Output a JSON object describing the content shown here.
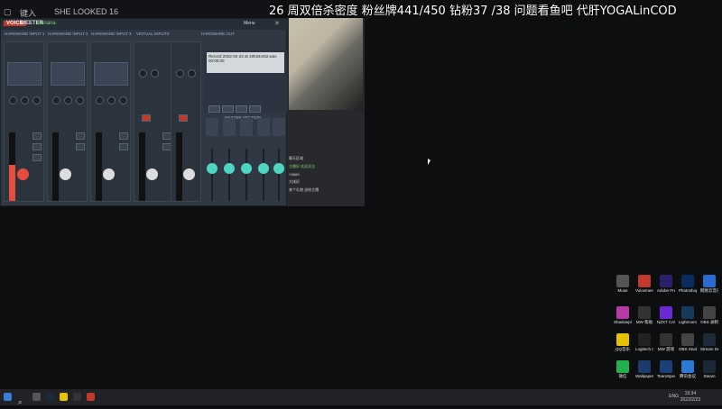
{
  "overlay": {
    "text": "26 周双倍杀密度 粉丝牌441/450 钻粉37 /38 问题看鱼吧 代肝YOGALinCOD"
  },
  "taskbar_top": {
    "item1": "键入",
    "item2": "SHE LOOKED 16"
  },
  "voicemeeter": {
    "logo_voice": "VOICE",
    "logo_meeter": "MEETER",
    "logo_banana": "Banana",
    "menu_label": "Menu",
    "channels": [
      "HARDWARE INPUT 1",
      "HARDWARE INPUT 2",
      "HARDWARE INPUT 3",
      "VIRTUAL INPUTS",
      "HARDWARE OUT"
    ],
    "master_section": "MASTER SECTION",
    "recorder_text": "Record 2022-02-23 at 19h34m52.wav",
    "recorder_time": "00:00:00"
  },
  "movie": {
    "chat_title": "聊天区域",
    "chat_lines": [
      "主播好 欢迎关注",
      "Y8888",
      "大佬好",
      "来个礼物 送给主播"
    ]
  },
  "taskbar": {
    "lang": "ENG",
    "time": "19:34",
    "date": "2022/2/23"
  },
  "desktop_icons": [
    {
      "label": "Muse",
      "color": "#555"
    },
    {
      "label": "Voicemeeter Banana",
      "color": "#c0392b"
    },
    {
      "label": "Adobe Premiere",
      "color": "#2a1f6a"
    },
    {
      "label": "Photoshop",
      "color": "#0b2b5c"
    },
    {
      "label": "网易云音乐 Streamer",
      "color": "#2a6ad3"
    },
    {
      "label": "Shadowplay",
      "color": "#b73aa6"
    },
    {
      "label": "MW 帮助",
      "color": "#333"
    },
    {
      "label": "NZXT CAM",
      "color": "#6a2ad3"
    },
    {
      "label": "Lightroom",
      "color": "#143a5c"
    },
    {
      "label": "OBS 录制",
      "color": "#444"
    },
    {
      "label": "QQ音乐",
      "color": "#e6c200"
    },
    {
      "label": "Logitech G HUB",
      "color": "#222"
    },
    {
      "label": "MW 游戏",
      "color": "#333"
    },
    {
      "label": "OBS Studio",
      "color": "#444"
    },
    {
      "label": "Stream Deck",
      "color": "#1d2a3a"
    },
    {
      "label": "微信",
      "color": "#22b14c"
    },
    {
      "label": "Wallpaper Engine",
      "color": "#1a3b6b"
    },
    {
      "label": "TeamSpeak",
      "color": "#1c3f7a"
    },
    {
      "label": "腾讯会议",
      "color": "#2a7ad3"
    },
    {
      "label": "Steam",
      "color": "#1b2838"
    }
  ]
}
